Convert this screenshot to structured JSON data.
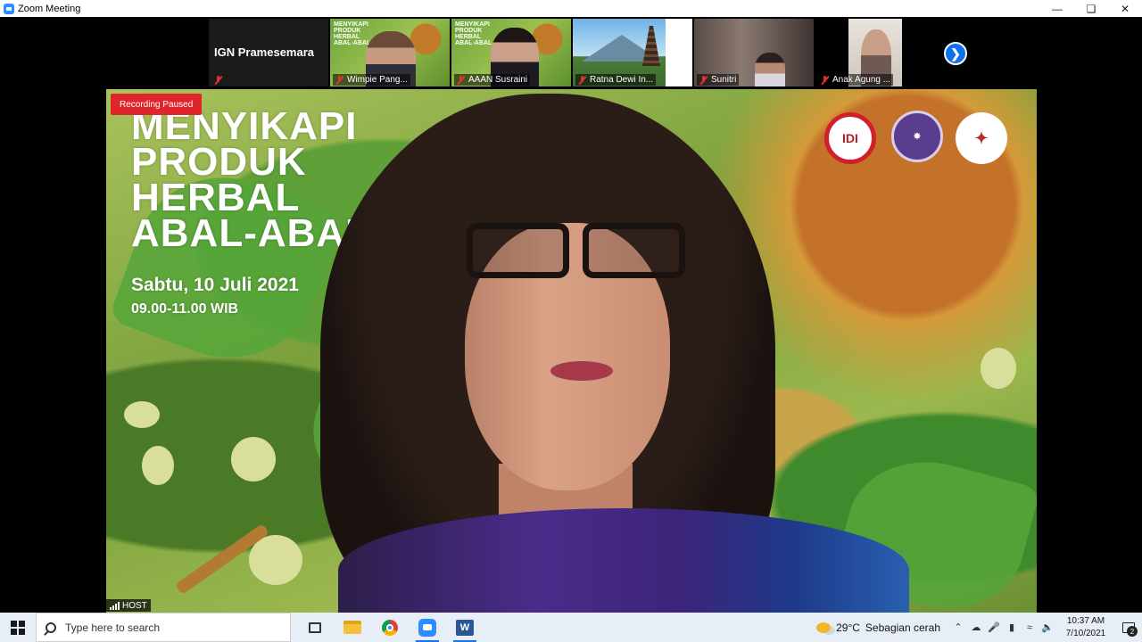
{
  "window": {
    "title": "Zoom Meeting",
    "controls": [
      "minimize-icon",
      "maximize-icon",
      "close-icon"
    ]
  },
  "gallery": {
    "tiles": [
      {
        "name": "IGN Pramesemara",
        "muted": true,
        "type": "name-only"
      },
      {
        "name": "Wimpie Pang...",
        "muted": true,
        "poster_title": "MENYIKAPI PRODUK HERBAL ABAL-ABAL"
      },
      {
        "name": "AAAN Susraini",
        "muted": true,
        "poster_title": "MENYIKAPI PRODUK HERBAL ABAL-ABAL"
      },
      {
        "name": "Ratna Dewi In...",
        "muted": true
      },
      {
        "name": "Sunitri",
        "muted": true
      },
      {
        "name": "Anak Agung ...",
        "muted": true
      }
    ],
    "next_icon": "chevron-right-icon"
  },
  "main_video": {
    "recording_status": "Recording Paused",
    "poster": {
      "lines": [
        "MENYIKAPI",
        "PRODUK",
        "HERBAL",
        "ABAL-ABAL"
      ],
      "date": "Sabtu, 10 Juli 2021",
      "time": "09.00-11.00 WIB"
    },
    "logos": [
      "IDI",
      "",
      ""
    ],
    "host_label": "HOST"
  },
  "taskbar": {
    "search_placeholder": "Type here to search",
    "weather": {
      "temp": "29°C",
      "condition": "Sebagian cerah"
    },
    "clock": {
      "time": "10:37 AM",
      "date": "7/10/2021"
    },
    "notification_count": "2"
  },
  "colors": {
    "recording": "#e0242b",
    "zoom_blue": "#2d8cff",
    "muted": "#e0332f"
  }
}
